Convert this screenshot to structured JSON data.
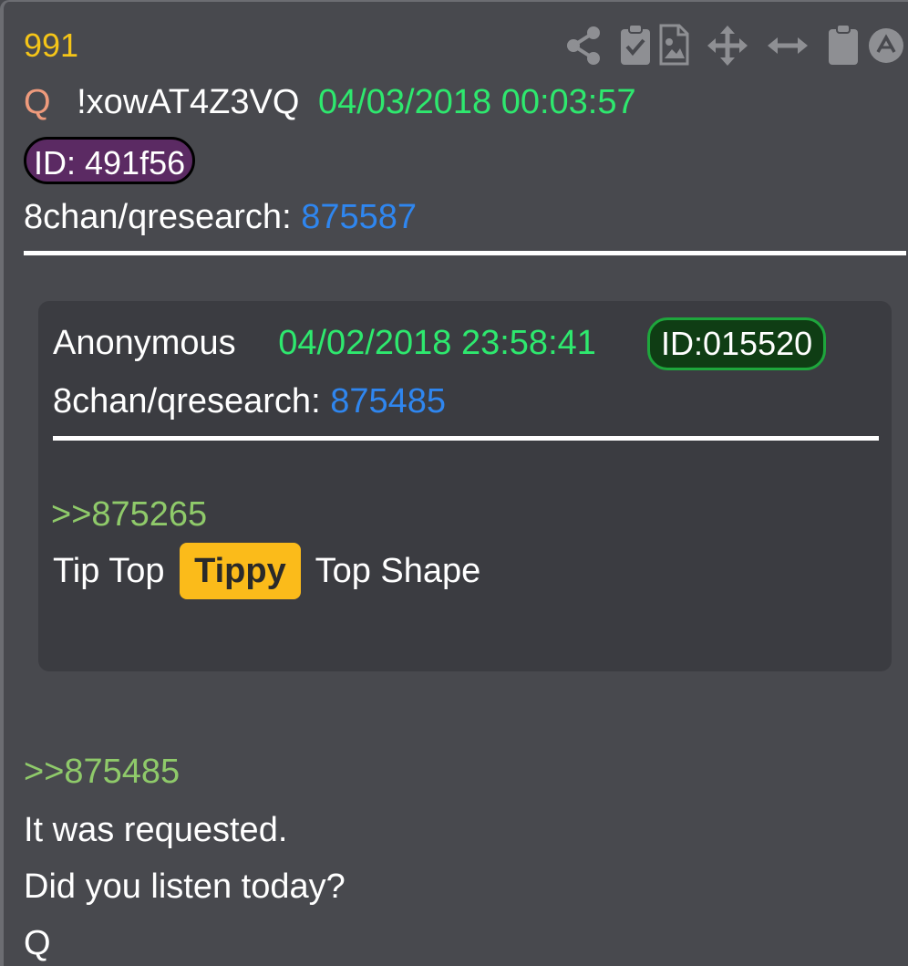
{
  "post": {
    "number": "991",
    "author": "Q",
    "tripcode": "!xowAT4Z3VQ",
    "date": "04/03/2018 00:03:57",
    "id_badge": "ID: 491f56",
    "source_label": "8chan/qresearch:",
    "source_link": "875587",
    "reply_link": ">>875485",
    "body_lines": [
      "It was requested.",
      "Did you listen today?",
      "Q"
    ]
  },
  "toolbar": {
    "icons": [
      "share-icon",
      "clipboard-check-icon",
      "image-file-icon",
      "move-icon",
      "resize-horizontal-icon",
      "clipboard-icon",
      "up-arrow-circle-icon"
    ]
  },
  "quoted_post": {
    "author": "Anonymous",
    "date": "04/02/2018 23:58:41",
    "id_badge": "ID:015520",
    "source_label": "8chan/qresearch:",
    "source_link": "875485",
    "reply_link": ">>875265",
    "body_before": "Tip Top",
    "body_highlight": "Tippy",
    "body_after": "Top Shape"
  },
  "colors": {
    "background": "#48494e",
    "quoted_background": "#3b3c41",
    "post_number": "#f5c518",
    "author": "#ee9a7c",
    "date": "#2ee86e",
    "link": "#2f86ef",
    "reply": "#8fca6a",
    "highlight": "#fbbb1a"
  }
}
